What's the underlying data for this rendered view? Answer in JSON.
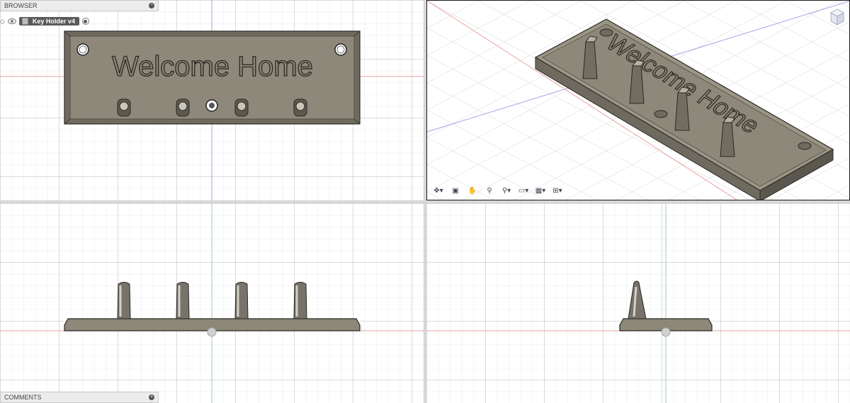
{
  "browser": {
    "title": "BROWSER",
    "component_label": "Key Holder v4"
  },
  "comments": {
    "title": "COMMENTS"
  },
  "model": {
    "engraved_text": "Welcome Home"
  },
  "icons": {
    "browser_collapse": "minus-circle-icon",
    "comments_expand": "plus-circle-icon",
    "visibility": "eye-icon",
    "activate": "radio-icon",
    "nav": [
      "orbit-icon",
      "look-at-icon",
      "pan-icon",
      "zoom-icon",
      "zoom-window-icon",
      "display-settings-icon",
      "grid-settings-icon",
      "viewports-icon"
    ]
  },
  "colors": {
    "model_face": "#8a8577",
    "model_top": "#a39e8f",
    "model_edge": "#3a3832",
    "axis_red": "#e4a0a0",
    "axis_green": "#96d896",
    "axis_blue": "#9898e4"
  }
}
